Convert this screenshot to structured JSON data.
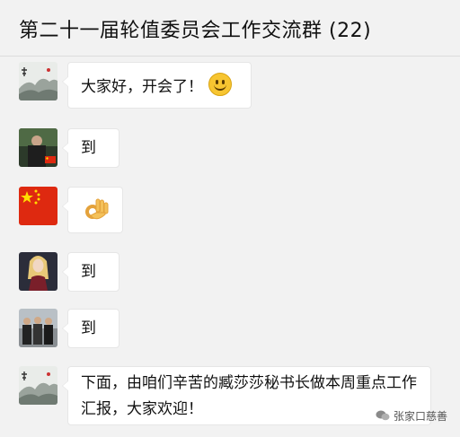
{
  "header": {
    "title": "第二十一届轮值委员会工作交流群 (22)"
  },
  "messages": [
    {
      "text": "大家好，开会了！",
      "emoji": "smile-emoji",
      "avatar": "ink-painting-avatar"
    },
    {
      "text": "到",
      "avatar": "person-with-flag-avatar"
    },
    {
      "text": "",
      "emoji": "ok-hand-emoji",
      "avatar": "china-flag-avatar"
    },
    {
      "text": "到",
      "avatar": "woman-illustration-avatar"
    },
    {
      "text": "到",
      "avatar": "group-photo-avatar"
    },
    {
      "text": "下面，由咱们辛苦的臧莎莎秘书长做本周重点工作汇报，大家欢迎！",
      "avatar": "ink-painting-avatar"
    }
  ],
  "watermark": {
    "text": "张家口慈善"
  },
  "colors": {
    "background": "#f2f2f2",
    "bubble": "#ffffff",
    "flag_red": "#de2910",
    "flag_yellow": "#ffde00"
  }
}
